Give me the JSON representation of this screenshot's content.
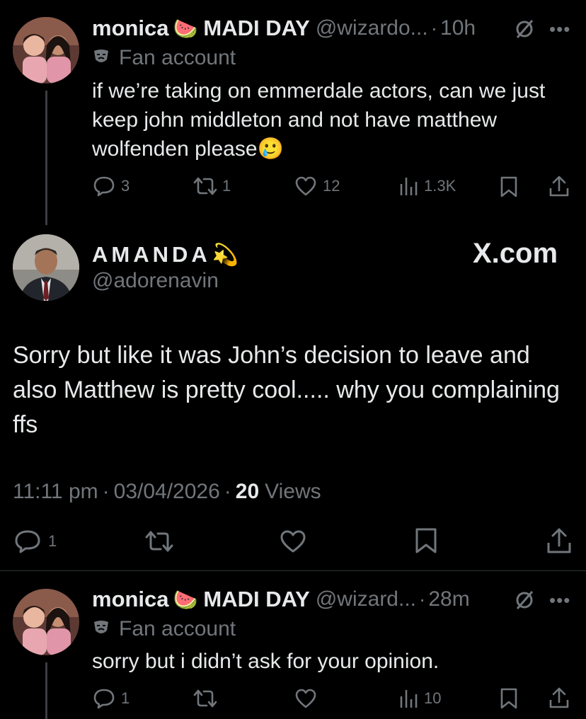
{
  "tweet1": {
    "name": "monica",
    "name_emoji": "🍉",
    "display2": "MADI DAY",
    "handle": "@wizardo...",
    "sep": "·",
    "time": "10h",
    "badge_icon": "mask-icon",
    "badge_text": "Fan account",
    "text": "if we’re taking on emmerdale actors, can we just keep john middleton and not have matthew wolfenden please",
    "text_emoji": "🥲",
    "replies": "3",
    "reposts": "1",
    "likes": "12",
    "views": "1.3K"
  },
  "main": {
    "name": "AMANDA",
    "name_emoji": "💫",
    "handle": "@adorenavin",
    "watermark": "X.com",
    "body": "Sorry but like it was John’s decision to leave and also Matthew is pretty cool..... why you complaining ffs",
    "time": "11:11 pm",
    "date": "03/04/2026",
    "views_count": "20",
    "views_label": "Views",
    "dot": "·",
    "replies": "1"
  },
  "tweet3": {
    "name": "monica",
    "name_emoji": "🍉",
    "display2": "MADI DAY",
    "handle": "@wizard...",
    "sep": "·",
    "time": "28m",
    "badge_text": "Fan account",
    "text": "sorry but i didn’t ask for your opinion.",
    "replies": "1",
    "views": "10"
  },
  "colors": {
    "background": "#000000",
    "text": "#e7e9ea",
    "muted": "#71767b",
    "divider": "#2f3336"
  }
}
